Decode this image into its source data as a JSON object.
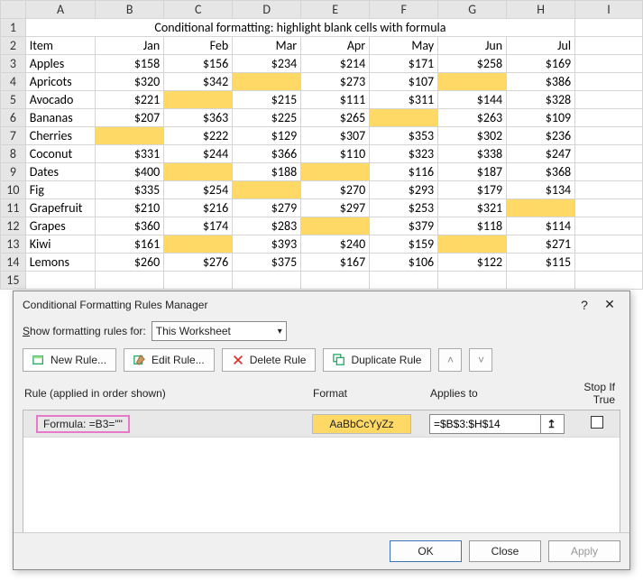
{
  "columns": [
    "A",
    "B",
    "C",
    "D",
    "E",
    "F",
    "G",
    "H",
    "I"
  ],
  "row_numbers": [
    1,
    2,
    3,
    4,
    5,
    6,
    7,
    8,
    9,
    10,
    11,
    12,
    13,
    14,
    15
  ],
  "title": "Conditional formatting: highlight blank cells with formula",
  "headers": {
    "item": "Item",
    "months": [
      "Jan",
      "Feb",
      "Mar",
      "Apr",
      "May",
      "Jun",
      "Jul"
    ]
  },
  "rows": [
    {
      "item": "Apples",
      "vals": [
        "$158",
        "$156",
        "$234",
        "$214",
        "$171",
        "$258",
        "$169"
      ]
    },
    {
      "item": "Apricots",
      "vals": [
        "$320",
        "$342",
        "",
        "$273",
        "$107",
        "",
        "$386"
      ]
    },
    {
      "item": "Avocado",
      "vals": [
        "$221",
        "",
        "$215",
        "$111",
        "$311",
        "$144",
        "$328"
      ]
    },
    {
      "item": "Bananas",
      "vals": [
        "$207",
        "$363",
        "$225",
        "$265",
        "",
        "$263",
        "$109"
      ]
    },
    {
      "item": "Cherries",
      "vals": [
        "",
        "$222",
        "$129",
        "$307",
        "$353",
        "$302",
        "$236"
      ]
    },
    {
      "item": "Coconut",
      "vals": [
        "$331",
        "$244",
        "$366",
        "$110",
        "$323",
        "$338",
        "$247"
      ]
    },
    {
      "item": "Dates",
      "vals": [
        "$400",
        "",
        "$188",
        "",
        "$116",
        "$187",
        "$368"
      ]
    },
    {
      "item": "Fig",
      "vals": [
        "$335",
        "$254",
        "",
        "$270",
        "$293",
        "$179",
        "$134"
      ]
    },
    {
      "item": "Grapefruit",
      "vals": [
        "$210",
        "$216",
        "$279",
        "$297",
        "$253",
        "$321",
        ""
      ]
    },
    {
      "item": "Grapes",
      "vals": [
        "$360",
        "$174",
        "$283",
        "",
        "$379",
        "$118",
        "$114"
      ]
    },
    {
      "item": "Kiwi",
      "vals": [
        "$161",
        "",
        "$393",
        "$240",
        "$159",
        "",
        "$271"
      ]
    },
    {
      "item": "Lemons",
      "vals": [
        "$260",
        "$276",
        "$375",
        "$167",
        "$106",
        "$122",
        "$115"
      ]
    }
  ],
  "dialog": {
    "title": "Conditional Formatting Rules Manager",
    "show_label_pre": "S",
    "show_label_post": "how formatting rules for:",
    "scope": "This Worksheet",
    "buttons": {
      "new": "New Rule...",
      "edit": "Edit Rule...",
      "delete": "Delete Rule",
      "dup": "Duplicate Rule"
    },
    "cols": {
      "rule": "Rule (applied in order shown)",
      "format": "Format",
      "applies": "Applies to",
      "stop": "Stop If True"
    },
    "rule": {
      "formula_label": "Formula: =B3=\"\"",
      "preview": "AaBbCcYyZz",
      "range": "=$B$3:$H$14"
    },
    "footer": {
      "ok": "OK",
      "close": "Close",
      "apply": "Apply"
    }
  }
}
